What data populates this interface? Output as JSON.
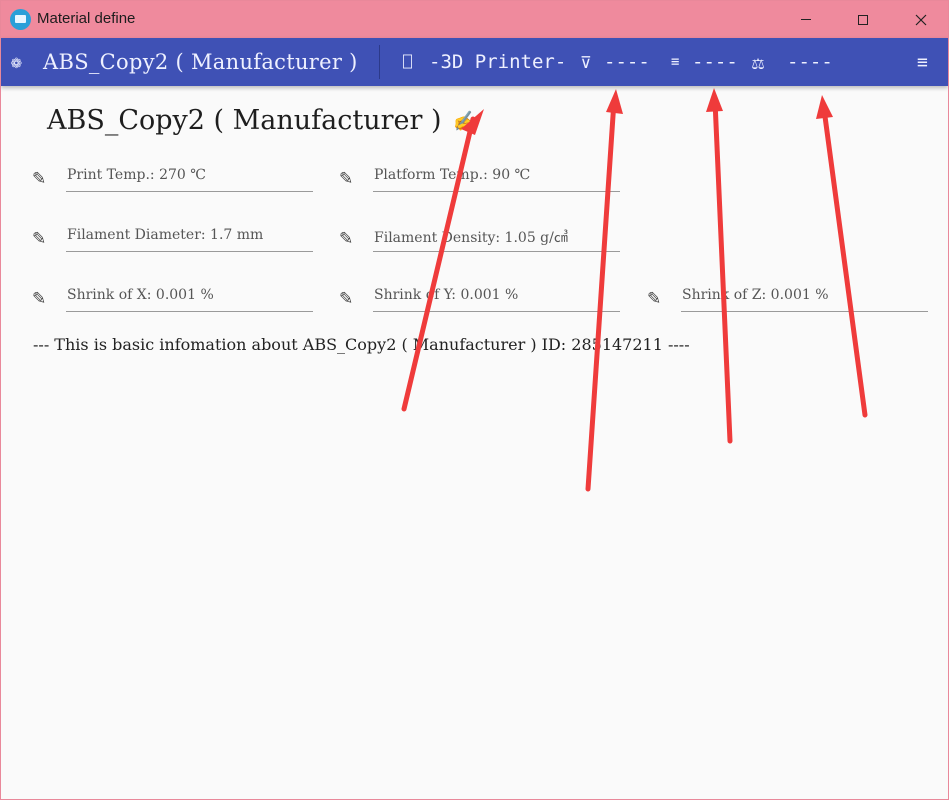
{
  "window": {
    "title": "Material define"
  },
  "toolbar": {
    "logo_glyph": "❁",
    "title": "ABS_Copy2 ( Manufacturer )",
    "printer_icon": "⎕",
    "printer_label": "-3D Printer-",
    "filter_icon": "⊽",
    "filter_value": "----",
    "list_icon": "≡",
    "list_value": "----",
    "scale_icon": "⚖",
    "scale_value": "----",
    "menu_icon": "≡"
  },
  "header": {
    "title": "ABS_Copy2 ( Manufacturer )",
    "edit_glyph": "✍"
  },
  "fields": {
    "icon_glyph": "✎",
    "print_temp": "Print Temp.: 270 ℃",
    "platform_temp": "Platform Temp.: 90 ℃",
    "filament_diameter": "Filament Diameter: 1.7 mm",
    "filament_density": "Filament Density: 1.05 g/㎤",
    "shrink_x": "Shrink of X: 0.001 %",
    "shrink_y": "Shrink of Y: 0.001 %",
    "shrink_z": "Shrink of Z: 0.001 %"
  },
  "info": {
    "line": "--- This is basic infomation about ABS_Copy2 ( Manufacturer )  ID: 285147211  ----"
  },
  "colors": {
    "titlebar": "#ef8a9d",
    "toolbar": "#3f51b5",
    "arrow": "#ef3b3b"
  }
}
